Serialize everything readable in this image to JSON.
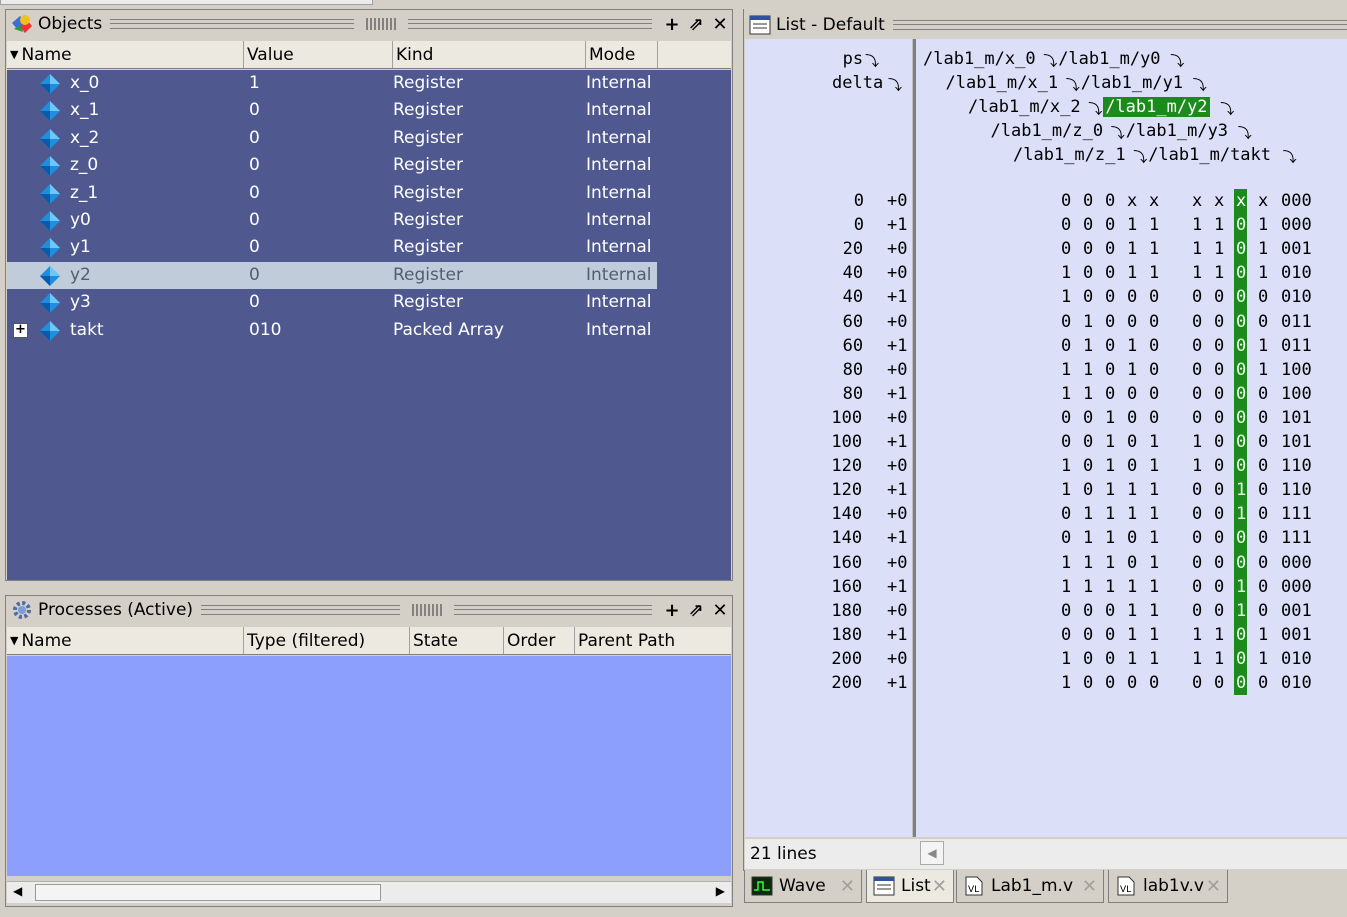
{
  "objects": {
    "title": "Objects",
    "columns": [
      "Name",
      "Value",
      "Kind",
      "Mode"
    ],
    "rows": [
      {
        "name": "x_0",
        "value": "1",
        "kind": "Register",
        "mode": "Internal"
      },
      {
        "name": "x_1",
        "value": "0",
        "kind": "Register",
        "mode": "Internal"
      },
      {
        "name": "x_2",
        "value": "0",
        "kind": "Register",
        "mode": "Internal"
      },
      {
        "name": "z_0",
        "value": "0",
        "kind": "Register",
        "mode": "Internal"
      },
      {
        "name": "z_1",
        "value": "0",
        "kind": "Register",
        "mode": "Internal"
      },
      {
        "name": "y0",
        "value": "0",
        "kind": "Register",
        "mode": "Internal"
      },
      {
        "name": "y1",
        "value": "0",
        "kind": "Register",
        "mode": "Internal"
      },
      {
        "name": "y2",
        "value": "0",
        "kind": "Register",
        "mode": "Internal",
        "selected": true
      },
      {
        "name": "y3",
        "value": "0",
        "kind": "Register",
        "mode": "Internal"
      },
      {
        "name": "takt",
        "value": "010",
        "kind": "Packed Array",
        "mode": "Internal",
        "expandable": true
      }
    ]
  },
  "processes": {
    "title": "Processes (Active)",
    "columns": [
      "Name",
      "Type (filtered)",
      "State",
      "Order",
      "Parent Path"
    ]
  },
  "list": {
    "title": "List - Default",
    "header_left": [
      "ps",
      "delta"
    ],
    "signal_headers": [
      [
        "/lab1_m/x_0",
        "/lab1_m/y0"
      ],
      [
        "/lab1_m/x_1",
        "/lab1_m/y1"
      ],
      [
        "/lab1_m/x_2",
        "/lab1_m/y2"
      ],
      [
        "/lab1_m/z_0",
        "/lab1_m/y3"
      ],
      [
        "/lab1_m/z_1",
        "/lab1_m/takt"
      ]
    ],
    "highlighted_signal": "/lab1_m/y2",
    "rows": [
      {
        "ps": "0",
        "delta": "+0",
        "v": [
          "0",
          "0",
          "0",
          "x",
          "x",
          "x",
          "x",
          "x",
          "x",
          "000"
        ]
      },
      {
        "ps": "0",
        "delta": "+1",
        "v": [
          "0",
          "0",
          "0",
          "1",
          "1",
          "1",
          "1",
          "0",
          "1",
          "000"
        ]
      },
      {
        "ps": "20",
        "delta": "+0",
        "v": [
          "0",
          "0",
          "0",
          "1",
          "1",
          "1",
          "1",
          "0",
          "1",
          "001"
        ]
      },
      {
        "ps": "40",
        "delta": "+0",
        "v": [
          "1",
          "0",
          "0",
          "1",
          "1",
          "1",
          "1",
          "0",
          "1",
          "010"
        ]
      },
      {
        "ps": "40",
        "delta": "+1",
        "v": [
          "1",
          "0",
          "0",
          "0",
          "0",
          "0",
          "0",
          "0",
          "0",
          "010"
        ]
      },
      {
        "ps": "60",
        "delta": "+0",
        "v": [
          "0",
          "1",
          "0",
          "0",
          "0",
          "0",
          "0",
          "0",
          "0",
          "011"
        ]
      },
      {
        "ps": "60",
        "delta": "+1",
        "v": [
          "0",
          "1",
          "0",
          "1",
          "0",
          "0",
          "0",
          "0",
          "1",
          "011"
        ]
      },
      {
        "ps": "80",
        "delta": "+0",
        "v": [
          "1",
          "1",
          "0",
          "1",
          "0",
          "0",
          "0",
          "0",
          "1",
          "100"
        ]
      },
      {
        "ps": "80",
        "delta": "+1",
        "v": [
          "1",
          "1",
          "0",
          "0",
          "0",
          "0",
          "0",
          "0",
          "0",
          "100"
        ]
      },
      {
        "ps": "100",
        "delta": "+0",
        "v": [
          "0",
          "0",
          "1",
          "0",
          "0",
          "0",
          "0",
          "0",
          "0",
          "101"
        ]
      },
      {
        "ps": "100",
        "delta": "+1",
        "v": [
          "0",
          "0",
          "1",
          "0",
          "1",
          "1",
          "0",
          "0",
          "0",
          "101"
        ]
      },
      {
        "ps": "120",
        "delta": "+0",
        "v": [
          "1",
          "0",
          "1",
          "0",
          "1",
          "1",
          "0",
          "0",
          "0",
          "110"
        ]
      },
      {
        "ps": "120",
        "delta": "+1",
        "v": [
          "1",
          "0",
          "1",
          "1",
          "1",
          "0",
          "0",
          "1",
          "0",
          "110"
        ]
      },
      {
        "ps": "140",
        "delta": "+0",
        "v": [
          "0",
          "1",
          "1",
          "1",
          "1",
          "0",
          "0",
          "1",
          "0",
          "111"
        ]
      },
      {
        "ps": "140",
        "delta": "+1",
        "v": [
          "0",
          "1",
          "1",
          "0",
          "1",
          "0",
          "0",
          "0",
          "0",
          "111"
        ]
      },
      {
        "ps": "160",
        "delta": "+0",
        "v": [
          "1",
          "1",
          "1",
          "0",
          "1",
          "0",
          "0",
          "0",
          "0",
          "000"
        ]
      },
      {
        "ps": "160",
        "delta": "+1",
        "v": [
          "1",
          "1",
          "1",
          "1",
          "1",
          "0",
          "0",
          "1",
          "0",
          "000"
        ]
      },
      {
        "ps": "180",
        "delta": "+0",
        "v": [
          "0",
          "0",
          "0",
          "1",
          "1",
          "0",
          "0",
          "1",
          "0",
          "001"
        ]
      },
      {
        "ps": "180",
        "delta": "+1",
        "v": [
          "0",
          "0",
          "0",
          "1",
          "1",
          "1",
          "1",
          "0",
          "1",
          "001"
        ]
      },
      {
        "ps": "200",
        "delta": "+0",
        "v": [
          "1",
          "0",
          "0",
          "1",
          "1",
          "1",
          "1",
          "0",
          "1",
          "010"
        ]
      },
      {
        "ps": "200",
        "delta": "+1",
        "v": [
          "1",
          "0",
          "0",
          "0",
          "0",
          "0",
          "0",
          "0",
          "0",
          "010"
        ]
      }
    ],
    "status": "21 lines"
  },
  "tabs": [
    {
      "label": "Wave",
      "icon": "wave-icon"
    },
    {
      "label": "List",
      "icon": "list-icon",
      "active": true
    },
    {
      "label": "Lab1_m.v",
      "icon": "verilog-file-icon"
    },
    {
      "label": "lab1v.v",
      "icon": "verilog-file-icon"
    }
  ],
  "colors": {
    "objects_bg": "#4f5990",
    "processes_bg": "#8c9ffc",
    "list_bg": "#dbe0f8",
    "highlight": "#1c8a1c"
  }
}
